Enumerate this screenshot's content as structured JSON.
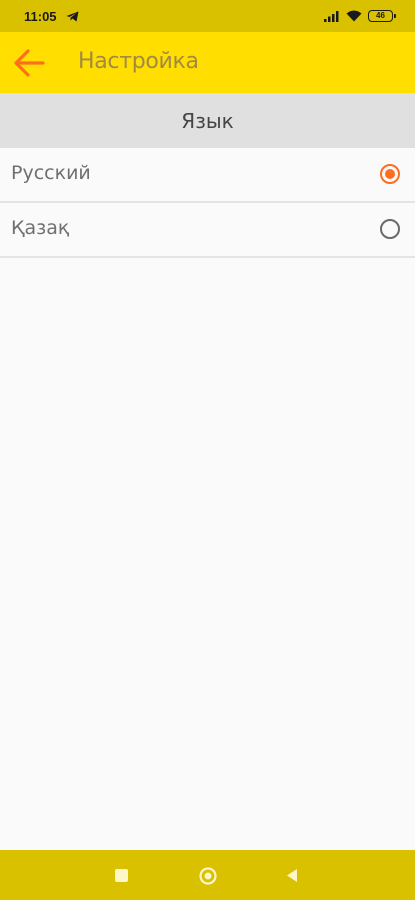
{
  "status_bar": {
    "time": "11:05",
    "battery": "46",
    "icons": [
      "telegram-icon",
      "signal-icon",
      "wifi-icon",
      "battery-icon"
    ]
  },
  "app_bar": {
    "title": "Настройка",
    "back_icon": "arrow-left-icon"
  },
  "section": {
    "title": "Язык"
  },
  "options": [
    {
      "label": "Русский",
      "selected": true
    },
    {
      "label": "Қазақ",
      "selected": false
    }
  ],
  "nav_bar": {
    "icons": [
      "recent-apps-icon",
      "home-icon",
      "back-icon"
    ]
  },
  "colors": {
    "app_bar": "#ffde00",
    "status_bar": "#d9c100",
    "accent": "#ff6d1f",
    "title_text": "#a08a45",
    "section_bg": "#e0e0e0",
    "background": "#fafafa"
  }
}
